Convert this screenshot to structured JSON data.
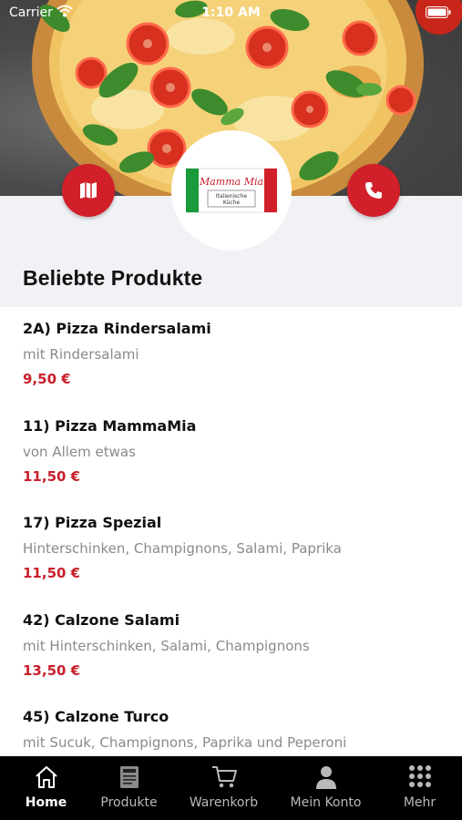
{
  "status_bar": {
    "carrier": "Carrier",
    "time": "1:10 AM"
  },
  "header": {
    "logo_text": "Mamma Mia",
    "logo_subtitle": "Italienische Küche",
    "map_icon": "map-icon",
    "phone_icon": "phone-icon"
  },
  "section": {
    "title": "Beliebte Produkte"
  },
  "products": [
    {
      "name": "2A) Pizza Rindersalami",
      "description": "mit Rindersalami",
      "price": "9,50 €"
    },
    {
      "name": "11) Pizza MammaMia",
      "description": "von Allem etwas",
      "price": "11,50 €"
    },
    {
      "name": "17) Pizza Spezial",
      "description": "Hinterschinken, Champignons, Salami, Paprika",
      "price": "11,50 €"
    },
    {
      "name": "42) Calzone Salami",
      "description": "mit Hinterschinken, Salami, Champignons",
      "price": "13,50 €"
    },
    {
      "name": "45) Calzone Turco",
      "description": "mit Sucuk, Champignons, Paprika und Peperoni",
      "price": ""
    }
  ],
  "tabs": [
    {
      "label": "Home",
      "icon": "home-icon",
      "active": true
    },
    {
      "label": "Produkte",
      "icon": "menu-icon",
      "active": false
    },
    {
      "label": "Warenkorb",
      "icon": "cart-icon",
      "active": false
    },
    {
      "label": "Mein Konto",
      "icon": "user-icon",
      "active": false
    },
    {
      "label": "Mehr",
      "icon": "grid-icon",
      "active": false
    }
  ],
  "colors": {
    "accent": "#d1202a",
    "price": "#c8202a",
    "tab_bar": "#000000"
  }
}
